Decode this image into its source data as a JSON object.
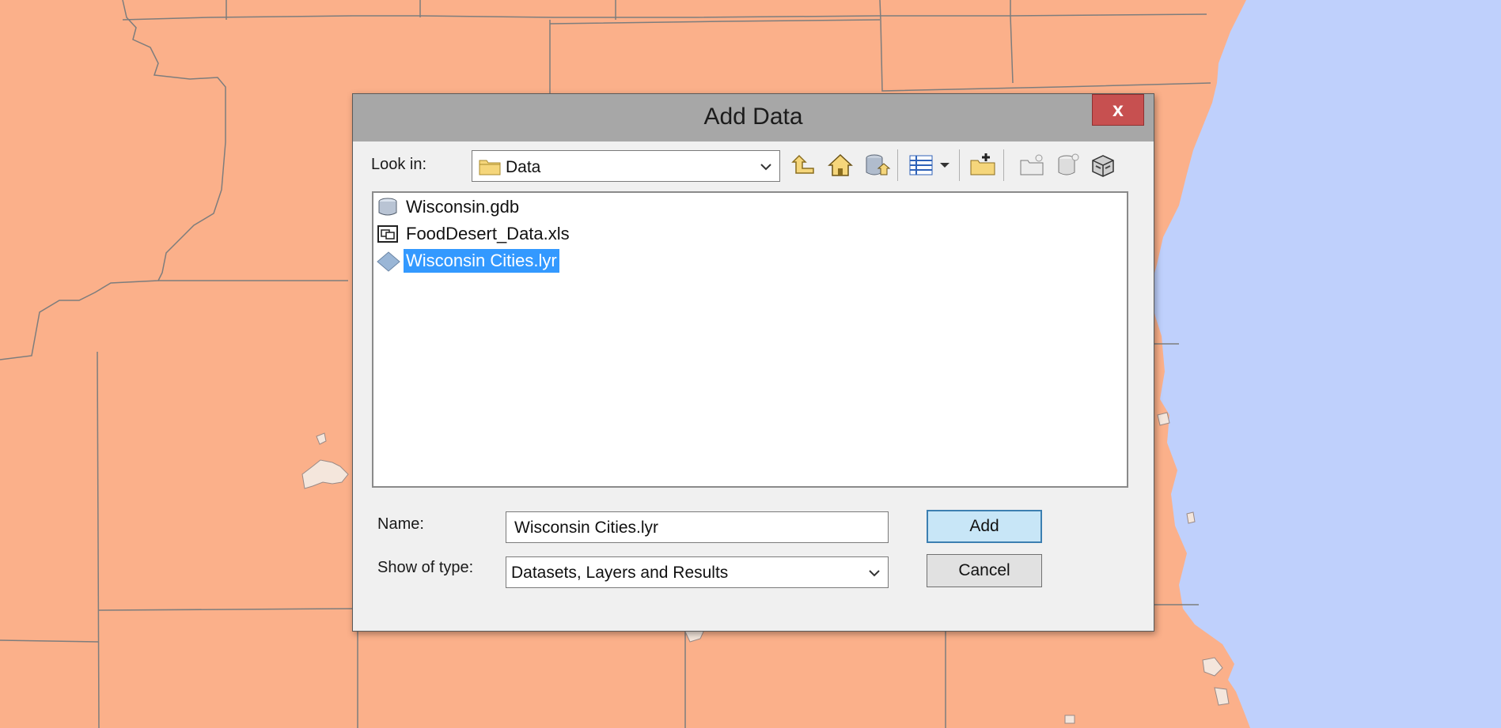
{
  "dialog": {
    "title": "Add Data",
    "close_label": "x",
    "look_in_label": "Look in:",
    "look_in_value": "Data",
    "files": [
      {
        "name": "Wisconsin.gdb",
        "icon": "geodatabase-icon",
        "selected": false
      },
      {
        "name": "FoodDesert_Data.xls",
        "icon": "excel-table-icon",
        "selected": false
      },
      {
        "name": "Wisconsin Cities.lyr",
        "icon": "layer-file-icon",
        "selected": true
      }
    ],
    "name_label": "Name:",
    "name_value": "Wisconsin Cities.lyr",
    "type_label": "Show of type:",
    "type_value": "Datasets, Layers and Results",
    "add_label": "Add",
    "cancel_label": "Cancel"
  },
  "toolbar": [
    "up-one-level-icon",
    "home-folder-icon",
    "go-to-default-geodatabase-icon",
    "view-details-icon",
    "view-menu-chevron-icon",
    "connect-to-folder-icon",
    "new-folder-icon",
    "new-geodatabase-icon",
    "new-toolbox-icon"
  ],
  "colors": {
    "land": "#fbb08a",
    "water": "#bfd0fc",
    "boundary": "#7d7d7d",
    "selection": "#3399ff",
    "close_button": "#c75050"
  }
}
